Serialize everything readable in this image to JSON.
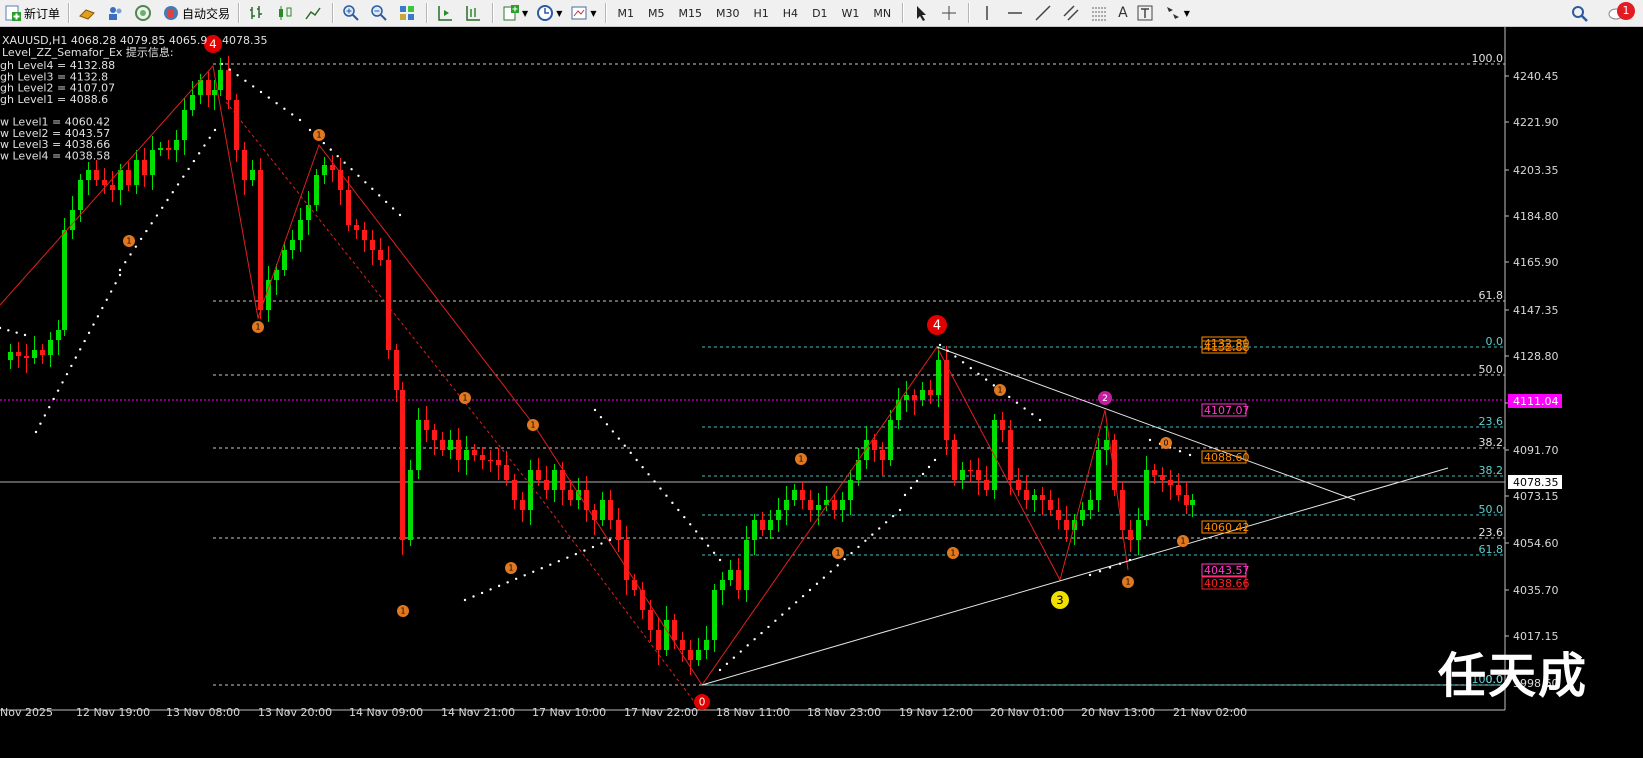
{
  "toolbar": {
    "new_order": "新订单",
    "auto_trading": "自动交易",
    "timeframes": [
      "M1",
      "M5",
      "M15",
      "M30",
      "H1",
      "H4",
      "D1",
      "W1",
      "MN"
    ],
    "font_label": "A",
    "notification_count": "1"
  },
  "chart_info": {
    "header": "XAUUSD,H1  4068.28 4079.85 4065.9",
    "header_tail": "4078.35",
    "indicator_title": "Level_ZZ_Semafor_Ex 提示信息:",
    "levels": [
      "gh Level4 = 4132.88",
      "gh Level3 = 4132.8",
      "gh Level2 = 4107.07",
      "gh Level1 = 4088.6",
      "",
      "w Level1 = 4060.42",
      "w Level2 = 4043.57",
      "w Level3 = 4038.66",
      "w Level4 = 4038.58"
    ]
  },
  "price_axis": {
    "ticks": [
      "4240.45",
      "4221.90",
      "4203.35",
      "4184.80",
      "4165.90",
      "4147.35",
      "4128.80",
      "4110.25",
      "4091.70",
      "4073.15",
      "4054.60",
      "4035.70",
      "4017.15",
      "3998.60"
    ],
    "current_price": "4078.35",
    "magenta_price": "4111.04"
  },
  "time_axis": {
    "labels": [
      "Nov 2025",
      "12 Nov 19:00",
      "13 Nov 08:00",
      "13 Nov 20:00",
      "14 Nov 09:00",
      "14 Nov 21:00",
      "17 Nov 10:00",
      "17 Nov 22:00",
      "18 Nov 11:00",
      "18 Nov 23:00",
      "19 Nov 12:00",
      "20 Nov 01:00",
      "20 Nov 13:00",
      "21 Nov 02:00"
    ]
  },
  "fib_left": [
    "100.0",
    "61.8",
    "50.0",
    "38.2",
    "23.6",
    "0.0"
  ],
  "fib_right": [
    "0.0",
    "23.6",
    "38.2",
    "50.0",
    "61.8",
    "100.0"
  ],
  "level_boxes": [
    {
      "label": "4132.88",
      "color": "#ff8c00"
    },
    {
      "label": "4132.80",
      "color": "#ff8c00"
    },
    {
      "label": "4107.07",
      "color": "#ff3cc8"
    },
    {
      "label": "4088.60",
      "color": "#ff8c00"
    },
    {
      "label": "4060.42",
      "color": "#ff8c00"
    },
    {
      "label": "4043.57",
      "color": "#ff3cc8"
    },
    {
      "label": "4038.66",
      "color": "#ff2020"
    }
  ],
  "semafor_labels": {
    "big4": "4",
    "big4b": "4",
    "s3": "3",
    "s2": "2",
    "s0": "0",
    "s1": "1"
  },
  "watermark": "任天成",
  "colors": {
    "bull": "#00e000",
    "bear": "#ff1a1a",
    "fib": "#c8c8c8",
    "fib2": "#40c0c0",
    "magenta": "#ff00ff"
  }
}
